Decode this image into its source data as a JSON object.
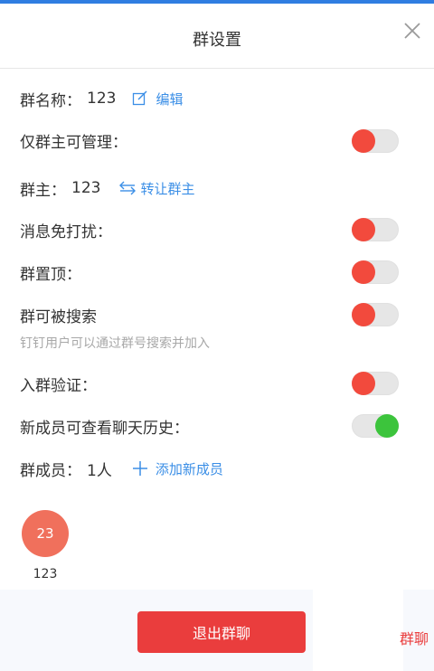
{
  "dialog": {
    "title": "群设置"
  },
  "group_name": {
    "label": "群名称：",
    "value": "123",
    "edit_label": "编辑"
  },
  "admin_only": {
    "label": "仅群主可管理：",
    "state": "off"
  },
  "owner": {
    "label": "群主：",
    "value": "123",
    "transfer_label": "转让群主"
  },
  "mute": {
    "label": "消息免打扰：",
    "state": "off"
  },
  "pin": {
    "label": "群置顶：",
    "state": "off"
  },
  "searchable": {
    "label": "群可被搜索",
    "state": "off",
    "hint": "钉钉用户可以通过群号搜索并加入"
  },
  "join_verify": {
    "label": "入群验证：",
    "state": "off"
  },
  "history_visible": {
    "label": "新成员可查看聊天历史：",
    "state": "on"
  },
  "members": {
    "label": "群成员：",
    "count": "1人",
    "add_label": "添加新成员"
  },
  "member_list": [
    {
      "avatar_text": "23",
      "name": "123"
    }
  ],
  "footer": {
    "exit_label": "退出群聊",
    "side_text": "群聊"
  },
  "colors": {
    "accent": "#3a8ee6",
    "toggle_off_knob": "#f24a3d",
    "toggle_on_knob": "#3cc43c",
    "exit_button": "#ea3d3d"
  },
  "icons": {
    "close": "close-icon",
    "edit": "edit-icon",
    "transfer": "transfer-icon",
    "add": "plus-icon"
  }
}
